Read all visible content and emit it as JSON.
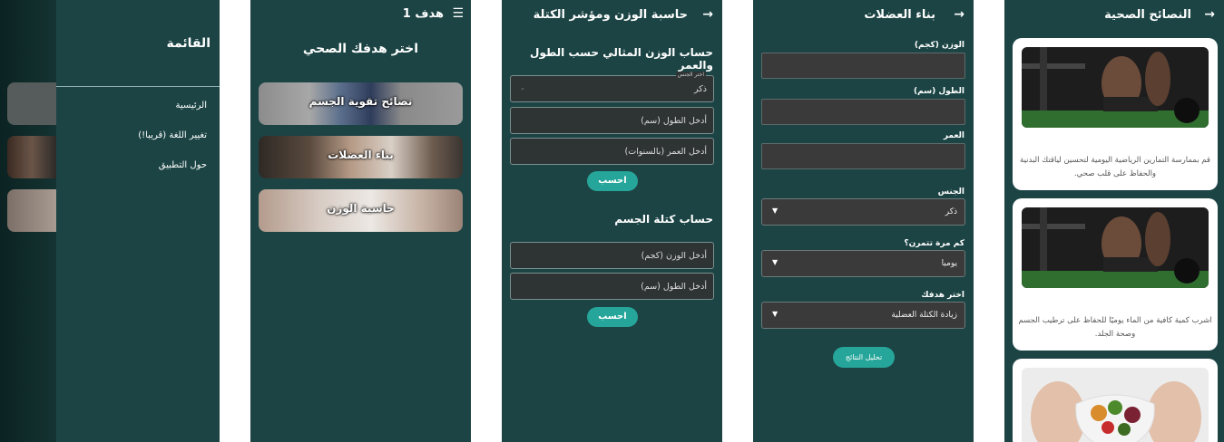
{
  "drawer": {
    "title": "القائمة",
    "items": [
      {
        "label": "الرئيسية"
      },
      {
        "label": "تغيير اللغة (قريبا!)"
      },
      {
        "label": "حول التطبيق"
      }
    ]
  },
  "goals": {
    "title": "هدف 1",
    "heading": "اختر هدفك الصحي",
    "cards": [
      {
        "label": "نصائح تقوية الجسم"
      },
      {
        "label": "بناء العضلات"
      },
      {
        "label": "حاسبة الوزن"
      }
    ]
  },
  "calculator": {
    "title": "حاسبة الوزن ومؤشر الكتلة",
    "ideal_section": "حساب الوزن المثالي حسب الطول والعمر",
    "gender_legend": "اختر الجنس",
    "gender_value": "ذكر",
    "height_placeholder": "أدخل الطول (سم)",
    "age_placeholder": "أدخل العمر (بالسنوات)",
    "calc_button": "احسب",
    "bmi_section": "حساب كتلة الجسم",
    "weight_placeholder": "أدخل الوزن (كجم)",
    "height2_placeholder": "أدخل الطول (سم)",
    "calc_button2": "احسب"
  },
  "muscle": {
    "title": "بناء العضلات",
    "weight_label": "الوزن (كجم)",
    "height_label": "الطول (سم)",
    "age_label": "العمر",
    "gender_label": "الجنس",
    "gender_value": "ذكر",
    "freq_label": "كم مرة تتمرن؟",
    "freq_value": "يوميا",
    "goal_label": "اختر هدفك",
    "goal_value": "زيادة الكتلة العضلية",
    "analyze_button": "تحليل النتائج"
  },
  "tips": {
    "title": "النصائح الصحية",
    "cards": [
      {
        "text": "قم بممارسة التمارين الرياضية اليومية لتحسين لياقتك البدنية والحفاظ على قلب صحي."
      },
      {
        "text": "اشرب كمية كافية من الماء يوميًا للحفاظ على ترطيب الجسم وصحة الجلد."
      }
    ]
  },
  "colors": {
    "background": "#1c4444",
    "accent": "#26a69a",
    "card": "#ffffff"
  },
  "icons": [
    "back-arrow-icon",
    "menu-icon",
    "dropdown-caret-icon"
  ]
}
